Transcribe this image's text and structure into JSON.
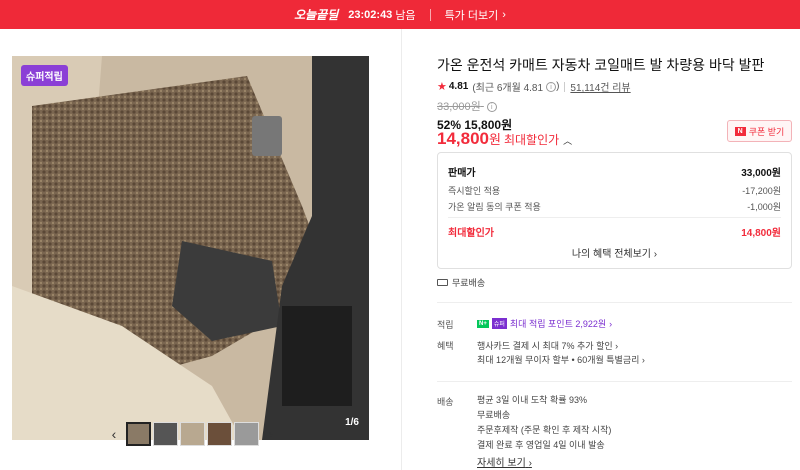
{
  "topbar": {
    "brand": "오늘끝딜",
    "timer": "23:02:43",
    "timer_suffix": "남음",
    "deal_link": "특가 더보기"
  },
  "gallery": {
    "badge": "슈퍼적립",
    "counter": "1/6",
    "prev_icon": "chevron-left-icon",
    "next_icon": "chevron-right-icon",
    "thumb_count": 5
  },
  "product": {
    "title": "가온 운전석 카매트 자동차 코일매트 발 차량용 바닥 발판",
    "rating": "4.81",
    "rating_recent": "(최근 6개월 4.81",
    "rating_recent_close": ")",
    "review_count": "51,114건 리뷰",
    "original_price": "33,000원",
    "discount_rate": "52%",
    "discount_price": "15,800원",
    "best_price": "14,800",
    "best_won": "원",
    "best_label": "최대할인가",
    "coupon_button": "쿠폰 받기"
  },
  "price_box": {
    "head_label": "판매가",
    "head_value": "33,000원",
    "rows": [
      {
        "label": "즉시할인 적용",
        "value": "-17,200원"
      },
      {
        "label": "가온 알림 동의 쿠폰 적용",
        "value": "-1,000원"
      }
    ],
    "max_label": "최대할인가",
    "max_value": "14,800원",
    "more_link": "나의 혜택 전체보기"
  },
  "shipping_free": "무료배송",
  "benefits": {
    "points_label": "적립",
    "points_text": "최대 적립 포인트 2,922원",
    "benefit_label": "혜택",
    "benefit_line1": "행사카드 결제 시 최대 7% 추가 할인",
    "benefit_line2": "최대 12개월 무이자 할부 • 60개월 특별금리"
  },
  "delivery": {
    "label": "배송",
    "lines": [
      "평균 3일 이내 도착 확률 93%",
      "무료배송",
      "주문후제작 (주문 확인 후 제작 시작)",
      "결제 완료 후 영업일 4일 이내 발송"
    ],
    "detail_link": "자세히 보기"
  },
  "colors": {
    "accent": "#f22b3b",
    "points": "#7b2fd0"
  }
}
